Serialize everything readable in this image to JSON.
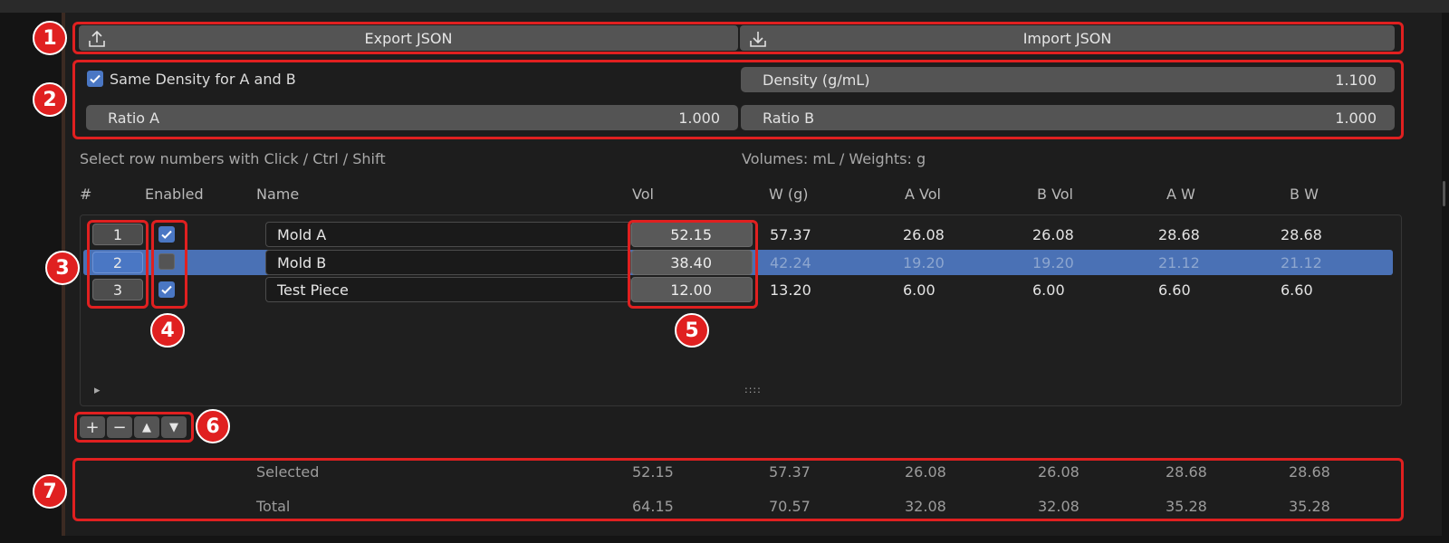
{
  "toolbar": {
    "export_label": "Export JSON",
    "export_icon": "upload-icon",
    "import_label": "Import JSON",
    "import_icon": "download-icon"
  },
  "density": {
    "same_density_label": "Same Density for A and B",
    "same_density_checked": true,
    "density_label": "Density (g/mL)",
    "density_value": "1.100",
    "ratio_a_label": "Ratio A",
    "ratio_a_value": "1.000",
    "ratio_b_label": "Ratio B",
    "ratio_b_value": "1.000"
  },
  "hints": {
    "select": "Select row numbers with Click / Ctrl / Shift",
    "units": "Volumes: mL / Weights: g"
  },
  "columns": {
    "num": "#",
    "enabled": "Enabled",
    "name": "Name",
    "vol": "Vol",
    "w": "W (g)",
    "a_vol": "A Vol",
    "b_vol": "B Vol",
    "a_w": "A W",
    "b_w": "B W"
  },
  "rows": [
    {
      "num": "1",
      "enabled": true,
      "selected": false,
      "name": "Mold A",
      "vol": "52.15",
      "w": "57.37",
      "a_vol": "26.08",
      "b_vol": "26.08",
      "a_w": "28.68",
      "b_w": "28.68"
    },
    {
      "num": "2",
      "enabled": false,
      "selected": true,
      "name": "Mold B",
      "vol": "38.40",
      "w": "42.24",
      "a_vol": "19.20",
      "b_vol": "19.20",
      "a_w": "21.12",
      "b_w": "21.12"
    },
    {
      "num": "3",
      "enabled": true,
      "selected": false,
      "name": "Test Piece",
      "vol": "12.00",
      "w": "13.20",
      "a_vol": "6.00",
      "b_vol": "6.00",
      "a_w": "6.60",
      "b_w": "6.60"
    }
  ],
  "list_footer": {
    "expand_glyph": "▸",
    "resize_glyph": "::::"
  },
  "row_tools": {
    "add": "+",
    "remove": "−",
    "up": "▲",
    "down": "▼"
  },
  "summary": {
    "selected": {
      "label": "Selected",
      "vol": "52.15",
      "w": "57.37",
      "a_vol": "26.08",
      "b_vol": "26.08",
      "a_w": "28.68",
      "b_w": "28.68"
    },
    "total": {
      "label": "Total",
      "vol": "64.15",
      "w": "70.57",
      "a_vol": "32.08",
      "b_vol": "32.08",
      "a_w": "35.28",
      "b_w": "35.28"
    }
  },
  "callouts": [
    "1",
    "2",
    "3",
    "4",
    "5",
    "6",
    "7"
  ],
  "colors": {
    "accent": "#4a77c4",
    "annotation": "#e02020",
    "panel": "#1d1d1d"
  }
}
